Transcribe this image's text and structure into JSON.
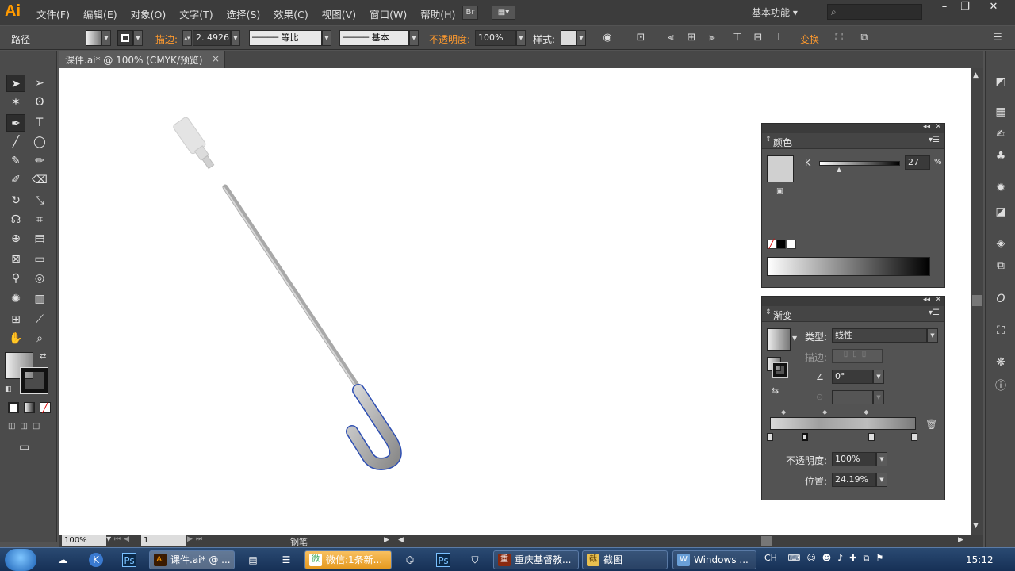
{
  "app": {
    "logo": "Ai"
  },
  "menu": [
    "文件(F)",
    "编辑(E)",
    "对象(O)",
    "文字(T)",
    "选择(S)",
    "效果(C)",
    "视图(V)",
    "窗口(W)",
    "帮助(H)"
  ],
  "menubar": {
    "bridge_label": "Br",
    "workspace": "基本功能"
  },
  "control": {
    "object_type": "路径",
    "stroke_label": "描边:",
    "stroke_value": "2. 4926",
    "profile_label": "等比",
    "brush_label": "基本",
    "opacity_label": "不透明度:",
    "opacity_value": "100%",
    "style_label": "样式:",
    "transform_label": "变换"
  },
  "document": {
    "tab_title": "课件.ai* @ 100% (CMYK/预览)",
    "close": "×"
  },
  "status": {
    "zoom": "100%",
    "page": "1",
    "tool": "钢笔"
  },
  "color_panel": {
    "title": "颜色",
    "channel": "K",
    "value": "27",
    "unit": "%"
  },
  "gradient_panel": {
    "title": "渐变",
    "type_label": "类型:",
    "type_value": "线性",
    "stroke_label": "描边:",
    "angle_value": "0°",
    "opacity_label": "不透明度:",
    "opacity_value": "100%",
    "location_label": "位置:",
    "location_value": "24.19%"
  },
  "taskbar": {
    "tasks": [
      {
        "label": "课件.ai* @ ...",
        "icon": "Ai"
      },
      {
        "label": "微信:1条新...",
        "icon": "微"
      },
      {
        "label": "重庆基督教...",
        "icon": "重"
      },
      {
        "label": "截图",
        "icon": "截"
      },
      {
        "label": "Windows ...",
        "icon": "W"
      }
    ],
    "clock": "15:12",
    "tray_lang": "CH"
  }
}
